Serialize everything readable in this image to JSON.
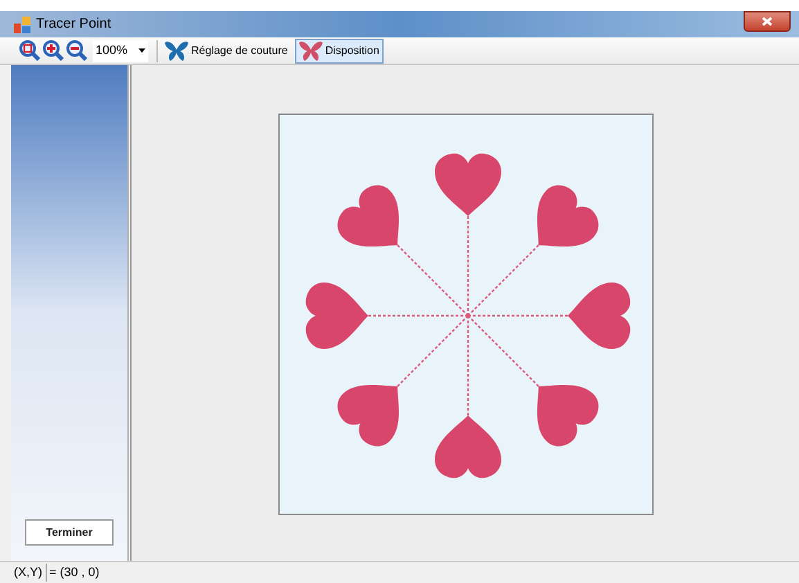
{
  "window": {
    "title": "Tracer Point"
  },
  "toolbar": {
    "zoom": "100%",
    "buttons": [
      {
        "label": "Réglage de couture",
        "selected": false,
        "color": "#1f6fb0"
      },
      {
        "label": "Disposition",
        "selected": true,
        "color": "#d0506a"
      }
    ]
  },
  "sidebar": {
    "button": "Terminer"
  },
  "status_bar": {
    "label": "(X,Y)",
    "value": "= (30 , 0)"
  }
}
